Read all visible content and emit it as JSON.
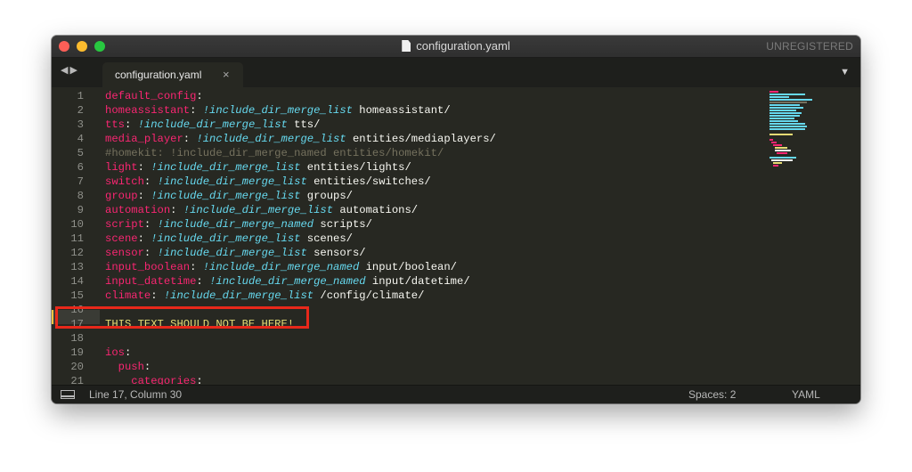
{
  "window": {
    "title": "configuration.yaml",
    "registration": "UNREGISTERED"
  },
  "tabs": [
    {
      "label": "configuration.yaml",
      "close": "×",
      "active": true
    }
  ],
  "nav": {
    "back": "◀",
    "forward": "▶",
    "dropdown": "▼"
  },
  "editor": {
    "highlighted_line": 17,
    "lines": [
      {
        "n": "1",
        "key": "default_config",
        "colon": ":",
        "tag": "",
        "val": ""
      },
      {
        "n": "2",
        "key": "homeassistant",
        "colon": ":",
        "tag": "!include_dir_merge_list",
        "val": "homeassistant/"
      },
      {
        "n": "3",
        "key": "tts",
        "colon": ":",
        "tag": "!include_dir_merge_list",
        "val": "tts/"
      },
      {
        "n": "4",
        "key": "media_player",
        "colon": ":",
        "tag": "!include_dir_merge_list",
        "val": "entities/mediaplayers/"
      },
      {
        "n": "5",
        "comment": "#homekit: !include_dir_merge_named entities/homekit/"
      },
      {
        "n": "6",
        "key": "light",
        "colon": ":",
        "tag": "!include_dir_merge_list",
        "val": "entities/lights/"
      },
      {
        "n": "7",
        "key": "switch",
        "colon": ":",
        "tag": "!include_dir_merge_list",
        "val": "entities/switches/"
      },
      {
        "n": "8",
        "key": "group",
        "colon": ":",
        "tag": "!include_dir_merge_list",
        "val": "groups/"
      },
      {
        "n": "9",
        "key": "automation",
        "colon": ":",
        "tag": "!include_dir_merge_list",
        "val": "automations/"
      },
      {
        "n": "10",
        "key": "script",
        "colon": ":",
        "tag": "!include_dir_merge_named",
        "val": "scripts/"
      },
      {
        "n": "11",
        "key": "scene",
        "colon": ":",
        "tag": "!include_dir_merge_list",
        "val": "scenes/"
      },
      {
        "n": "12",
        "key": "sensor",
        "colon": ":",
        "tag": "!include_dir_merge_list",
        "val": "sensors/"
      },
      {
        "n": "13",
        "key": "input_boolean",
        "colon": ":",
        "tag": "!include_dir_merge_named",
        "val": "input/boolean/"
      },
      {
        "n": "14",
        "key": "input_datetime",
        "colon": ":",
        "tag": "!include_dir_merge_named",
        "val": "input/datetime/"
      },
      {
        "n": "15",
        "key": "climate",
        "colon": ":",
        "tag": "!include_dir_merge_list",
        "val": "/config/climate/"
      },
      {
        "n": "16"
      },
      {
        "n": "17",
        "plain": "THIS TEXT SHOULD NOT BE HERE!"
      },
      {
        "n": "18"
      },
      {
        "n": "19",
        "key": "ios",
        "colon": ":"
      },
      {
        "n": "20",
        "key": "push",
        "colon": ":",
        "indent": "  "
      },
      {
        "n": "21",
        "key": "categories",
        "colon": ":",
        "indent": "    "
      }
    ]
  },
  "status": {
    "position": "Line 17, Column 30",
    "spaces": "Spaces: 2",
    "syntax": "YAML"
  },
  "colors": {
    "background": "#272822",
    "key": "#f92672",
    "tag": "#66d9ef",
    "comment": "#75715e",
    "string": "#e6db74",
    "annotation": "#e8281a"
  }
}
